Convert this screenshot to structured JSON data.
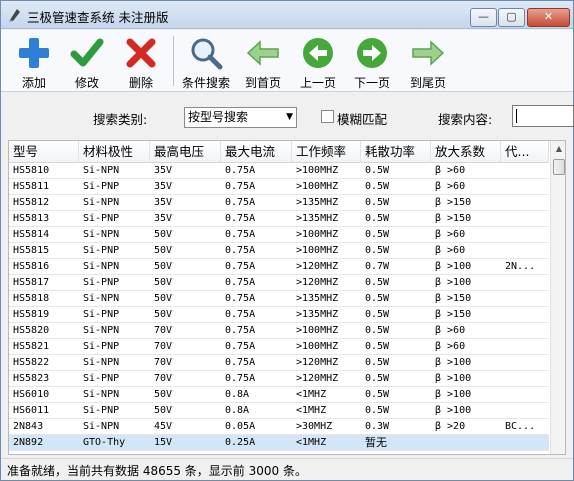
{
  "window": {
    "title": "三极管速查系统 未注册版"
  },
  "window_buttons": {
    "minimize": "—",
    "maximize": "▢",
    "close": "✕"
  },
  "toolbar": {
    "buttons": [
      {
        "label": "添加",
        "icon": "add-plus-icon"
      },
      {
        "label": "修改",
        "icon": "checkmark-icon"
      },
      {
        "label": "删除",
        "icon": "delete-x-icon"
      },
      {
        "label": "条件搜索",
        "icon": "magnifier-icon"
      },
      {
        "label": "到首页",
        "icon": "first-page-arrow-icon"
      },
      {
        "label": "上一页",
        "icon": "previous-page-arrow-icon"
      },
      {
        "label": "下一页",
        "icon": "next-page-arrow-icon"
      },
      {
        "label": "到尾页",
        "icon": "last-page-arrow-icon"
      }
    ]
  },
  "search": {
    "category_label": "搜索类别:",
    "category_value": "按型号搜索",
    "fuzzy_label": "模糊匹配",
    "content_label": "搜索内容:"
  },
  "table": {
    "columns": [
      "型号",
      "材料极性",
      "最高电压",
      "最大电流",
      "工作频率",
      "耗散功率",
      "放大系数",
      "代..."
    ],
    "rows": [
      [
        "HS5810",
        "Si-NPN",
        "35V",
        "0.75A",
        ">100MHZ",
        "0.5W",
        "β >60",
        ""
      ],
      [
        "HS5811",
        "Si-PNP",
        "35V",
        "0.75A",
        ">100MHZ",
        "0.5W",
        "β >60",
        ""
      ],
      [
        "HS5812",
        "Si-NPN",
        "35V",
        "0.75A",
        ">135MHZ",
        "0.5W",
        "β >150",
        ""
      ],
      [
        "HS5813",
        "Si-PNP",
        "35V",
        "0.75A",
        ">135MHZ",
        "0.5W",
        "β >150",
        ""
      ],
      [
        "HS5814",
        "Si-NPN",
        "50V",
        "0.75A",
        ">100MHZ",
        "0.5W",
        "β >60",
        ""
      ],
      [
        "HS5815",
        "Si-PNP",
        "50V",
        "0.75A",
        ">100MHZ",
        "0.5W",
        "β >60",
        ""
      ],
      [
        "HS5816",
        "Si-NPN",
        "50V",
        "0.75A",
        ">120MHZ",
        "0.7W",
        "β >100",
        "2N..."
      ],
      [
        "HS5817",
        "Si-PNP",
        "50V",
        "0.75A",
        ">120MHZ",
        "0.5W",
        "β >100",
        ""
      ],
      [
        "HS5818",
        "Si-NPN",
        "50V",
        "0.75A",
        ">135MHZ",
        "0.5W",
        "β >150",
        ""
      ],
      [
        "HS5819",
        "Si-PNP",
        "50V",
        "0.75A",
        ">135MHZ",
        "0.5W",
        "β >150",
        ""
      ],
      [
        "HS5820",
        "Si-NPN",
        "70V",
        "0.75A",
        ">100MHZ",
        "0.5W",
        "β >60",
        ""
      ],
      [
        "HS5821",
        "Si-PNP",
        "70V",
        "0.75A",
        ">100MHZ",
        "0.5W",
        "β >60",
        ""
      ],
      [
        "HS5822",
        "Si-NPN",
        "70V",
        "0.75A",
        ">120MHZ",
        "0.5W",
        "β >100",
        ""
      ],
      [
        "HS5823",
        "Si-PNP",
        "70V",
        "0.75A",
        ">120MHZ",
        "0.5W",
        "β >100",
        ""
      ],
      [
        "HS6010",
        "Si-NPN",
        "50V",
        "0.8A",
        "<1MHZ",
        "0.5W",
        "β >100",
        ""
      ],
      [
        "HS6011",
        "Si-PNP",
        "50V",
        "0.8A",
        "<1MHZ",
        "0.5W",
        "β >100",
        ""
      ],
      [
        "2N843",
        "Si-NPN",
        "45V",
        "0.05A",
        ">30MHZ",
        "0.3W",
        "β >20",
        "BC..."
      ],
      [
        "2N892",
        "GTO-Thy",
        "15V",
        "0.25A",
        "<1MHZ",
        "暂无",
        "",
        ""
      ]
    ],
    "selected_row": 17
  },
  "status": {
    "text": "准备就绪，当前共有数据 48655 条，显示前 3000 条。"
  },
  "colors": {
    "add_icon": "#2f7fd6",
    "check_icon": "#2e9b3c",
    "delete_icon": "#d42a22",
    "nav_arrow": "#46a83b",
    "selection": "#d3e6f7"
  }
}
